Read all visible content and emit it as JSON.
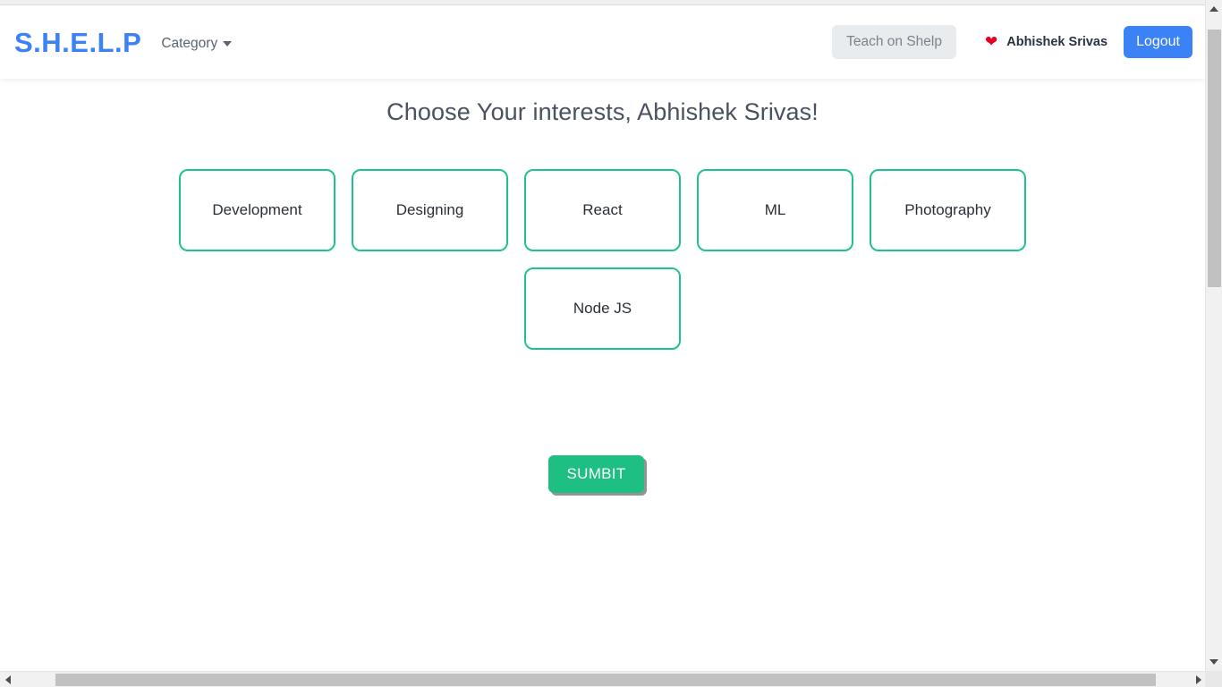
{
  "navbar": {
    "brand": "S.H.E.L.P",
    "category_label": "Category",
    "teach_label": "Teach on Shelp",
    "heart_icon": "heart-icon",
    "user_name": "Abhishek Srivas",
    "logout_label": "Logout",
    "brand_color": "#3b82f6",
    "logout_bg": "#3b82f6",
    "teach_bg": "#e9ecef",
    "heart_color": "#e60023"
  },
  "main": {
    "title": "Choose Your interests, Abhishek Srivas!",
    "interests": [
      {
        "label": "Development"
      },
      {
        "label": "Designing"
      },
      {
        "label": "React"
      },
      {
        "label": "ML"
      },
      {
        "label": "Photography"
      },
      {
        "label": "Node JS"
      }
    ],
    "submit_label": "SUMBIT",
    "card_border_color": "#1fc48b",
    "submit_bg": "#1dbf82"
  },
  "scrollbars": {
    "vertical_thumb": "vertical-scrollbar-thumb",
    "horizontal_thumb": "horizontal-scrollbar-thumb"
  }
}
